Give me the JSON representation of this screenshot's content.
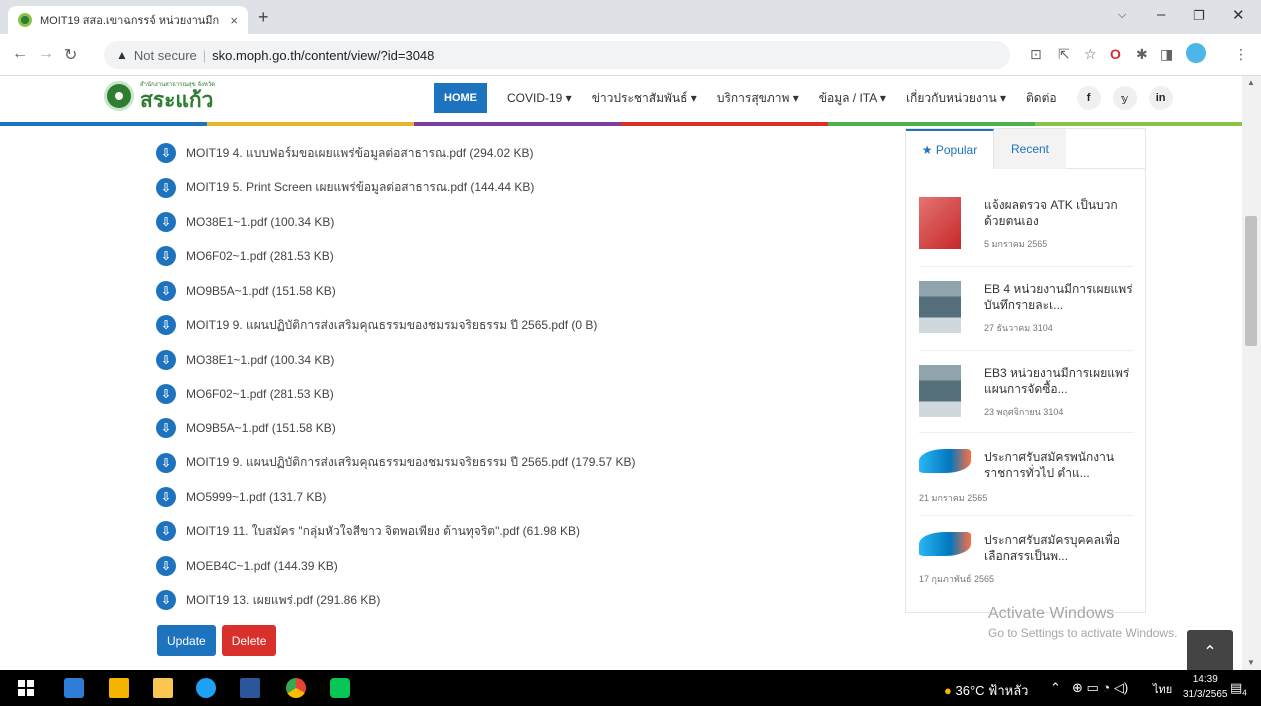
{
  "browser": {
    "tab_title": "MOIT19 สสอ.เขาฉกรรจ์ หน่วยงานมีก",
    "tab_close": "×",
    "new_tab": "+",
    "not_secure": "Not secure",
    "url": "sko.moph.go.th/content/view/?id=3048"
  },
  "site": {
    "logo_small": "สำนักงานสาธารณสุข จังหวัด",
    "logo_big": "สระแก้ว",
    "nav": [
      "HOME",
      "COVID-19 ▾",
      "ข่าวประชาสัมพันธ์ ▾",
      "บริการสุขภาพ ▾",
      "ข้อมูล / ITA ▾",
      "เกี่ยวกับหน่วยงาน ▾",
      "ติดต่อ"
    ],
    "social": [
      "f",
      "𝕪",
      "in"
    ],
    "color_bar": [
      "#1e73be",
      "#e3b92c",
      "#7b3fa0",
      "#d9302c",
      "#4caf50",
      "#8bc34a"
    ]
  },
  "files": [
    "MOIT19 4. แบบฟอร์มขอเผยแพร่ข้อมูลต่อสาธารณ.pdf (294.02 KB)",
    "MOIT19 5. Print Screen เผยแพร่ข้อมูลต่อสาธารณ.pdf (144.44 KB)",
    "MO38E1~1.pdf (100.34 KB)",
    "MO6F02~1.pdf (281.53 KB)",
    "MO9B5A~1.pdf (151.58 KB)",
    "MOIT19 9. แผนปฏิบัติการส่งเสริมคุณธรรมของชมรมจริยธรรม ปี 2565.pdf (0 B)",
    "MO38E1~1.pdf (100.34 KB)",
    "MO6F02~1.pdf (281.53 KB)",
    "MO9B5A~1.pdf (151.58 KB)",
    "MOIT19 9. แผนปฏิบัติการส่งเสริมคุณธรรมของชมรมจริยธรรม ปี 2565.pdf (179.57 KB)",
    "MO5999~1.pdf (131.7 KB)",
    "MOIT19 11. ใบสมัคร \"กลุ่มหัวใจสีขาว จิตพอเพียง ต้านทุจริต\".pdf (61.98 KB)",
    "MOEB4C~1.pdf (144.39 KB)",
    "MOIT19 13. เผยแพร่.pdf (291.86 KB)"
  ],
  "buttons": {
    "update": "Update",
    "delete": "Delete"
  },
  "sidebar": {
    "tab_popular": "★ Popular",
    "tab_recent": "Recent",
    "items": [
      {
        "title": "แจ้งผลตรวจ ATK เป็นบวก ด้วยตนเอง",
        "date": "5 มกราคม 2565"
      },
      {
        "title": "EB 4 หน่วยงานมีการเผยแพร่บันทึกรายละเ...",
        "date": "27 ธันวาคม 3104"
      },
      {
        "title": "EB3 หน่วยงานมีการเผยแพร่แผนการจัดซื้อ...",
        "date": "23 พฤศจิกายน 3104"
      },
      {
        "title": "ประกาศรับสมัครพนักงานราชการทั่วไป ตำแ...",
        "date": "21 มกราคม 2565"
      },
      {
        "title": "ประกาศรับสมัครบุคคลเพื่อเลือกสรรเป็นพ...",
        "date": "17 กุมภาพันธ์ 2565"
      }
    ]
  },
  "overlay": {
    "activate_title": "Activate Windows",
    "activate_sub": "Go to Settings to activate Windows."
  },
  "taskbar": {
    "weather": "36°C ฟ้าหลัว",
    "lang": "ไทย",
    "time": "14:39",
    "date": "31/3/2565",
    "notif_count": "4"
  }
}
